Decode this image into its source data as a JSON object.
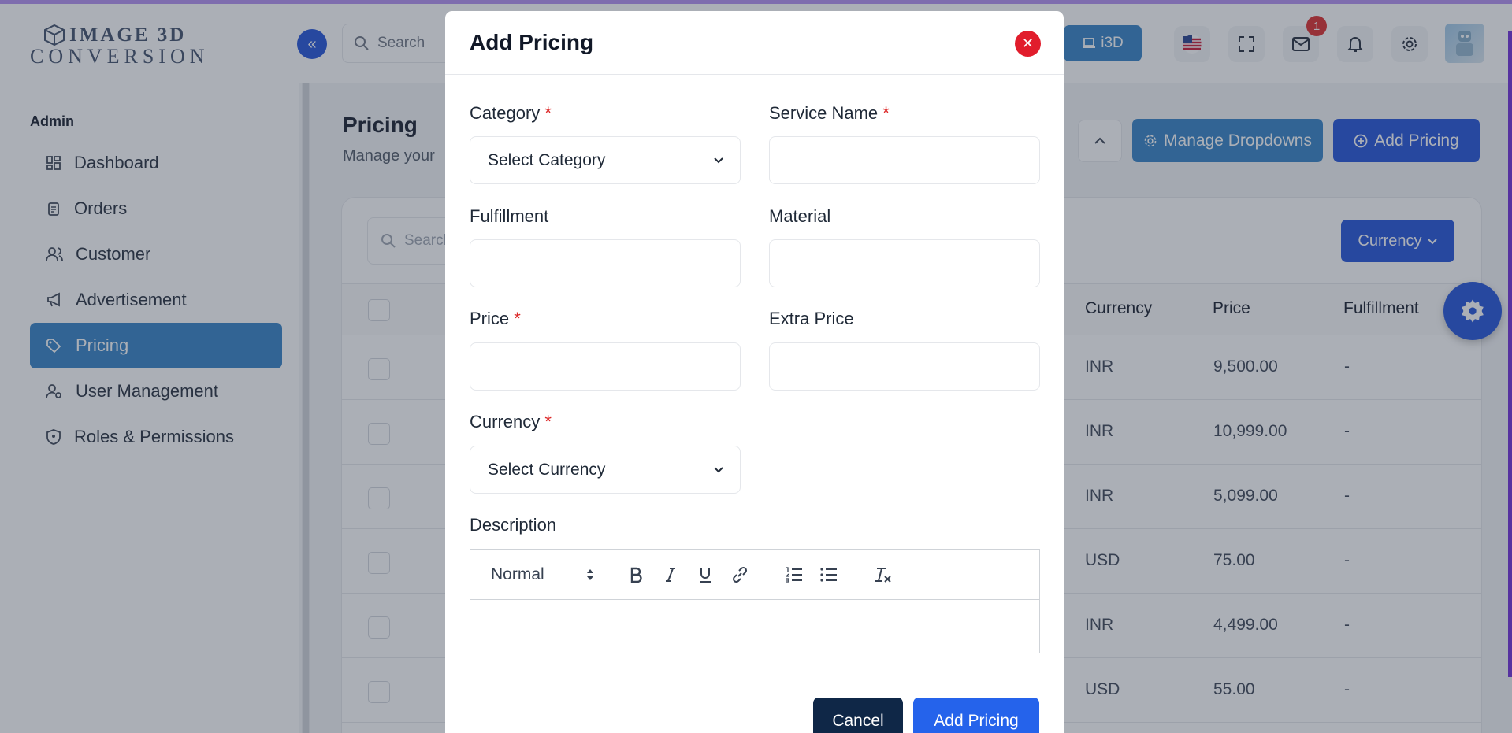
{
  "header": {
    "logo_line1": "IMAGE 3D",
    "logo_line2": "CONVERSION",
    "search_placeholder": "Search",
    "i3d_label": "i3D",
    "mail_badge": "1"
  },
  "sidebar": {
    "section_title": "Admin",
    "items": [
      {
        "label": "Dashboard"
      },
      {
        "label": "Orders"
      },
      {
        "label": "Customer"
      },
      {
        "label": "Advertisement"
      },
      {
        "label": "Pricing"
      },
      {
        "label": "User Management"
      },
      {
        "label": "Roles & Permissions"
      }
    ]
  },
  "main": {
    "title": "Pricing",
    "subtitle": "Manage your",
    "manage_dropdowns_label": "Manage Dropdowns",
    "add_pricing_label": "Add Pricing",
    "table_search_placeholder": "Search",
    "currency_button": "Currency",
    "columns": [
      "Currency",
      "Price",
      "Fulfillment"
    ],
    "rows": [
      {
        "currency": "INR",
        "price": "9,500.00",
        "fulfillment": "-"
      },
      {
        "currency": "INR",
        "price": "10,999.00",
        "fulfillment": "-"
      },
      {
        "currency": "INR",
        "price": "5,099.00",
        "fulfillment": "-"
      },
      {
        "currency": "USD",
        "price": "75.00",
        "fulfillment": "-"
      },
      {
        "currency": "INR",
        "price": "4,499.00",
        "fulfillment": "-"
      },
      {
        "currency": "USD",
        "price": "55.00",
        "fulfillment": "-"
      }
    ]
  },
  "modal": {
    "title": "Add Pricing",
    "fields": {
      "category": {
        "label": "Category",
        "placeholder": "Select Category"
      },
      "service_name": {
        "label": "Service Name",
        "value": ""
      },
      "fulfillment": {
        "label": "Fulfillment",
        "value": ""
      },
      "material": {
        "label": "Material",
        "value": ""
      },
      "price": {
        "label": "Price",
        "value": ""
      },
      "extra_price": {
        "label": "Extra Price",
        "value": ""
      },
      "currency": {
        "label": "Currency",
        "placeholder": "Select Currency"
      },
      "description": {
        "label": "Description",
        "format": "Normal"
      }
    },
    "required_mark": "*",
    "cancel_label": "Cancel",
    "submit_label": "Add Pricing"
  },
  "colors": {
    "primary": "#1d4ed8",
    "accent": "#2f7fc4",
    "danger": "#e11d2c",
    "dark": "#0f2747"
  }
}
